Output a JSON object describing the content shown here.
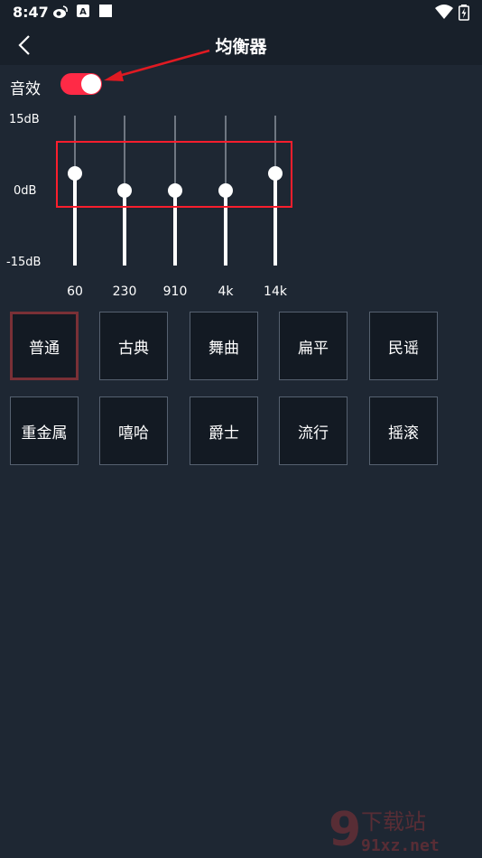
{
  "status_bar": {
    "time": "8:47",
    "icons": [
      "weibo-icon",
      "a-icon",
      "square-icon",
      "wifi-icon",
      "battery-icon"
    ]
  },
  "toolbar": {
    "title": "均衡器",
    "back_icon": "chevron-left-icon"
  },
  "sound_effect": {
    "label": "音效",
    "enabled": true,
    "on_color": "#ff2a46"
  },
  "equalizer": {
    "db_labels": {
      "max": "15dB",
      "mid": "0dB",
      "min": "-15dB"
    },
    "range_db": [
      -15,
      15
    ],
    "bands": [
      {
        "freq": "60",
        "gain_db": 3.5
      },
      {
        "freq": "230",
        "gain_db": 0
      },
      {
        "freq": "910",
        "gain_db": 0
      },
      {
        "freq": "4k",
        "gain_db": 0
      },
      {
        "freq": "14k",
        "gain_db": 3.5
      }
    ]
  },
  "presets": [
    {
      "label": "普通",
      "selected": true
    },
    {
      "label": "古典",
      "selected": false
    },
    {
      "label": "舞曲",
      "selected": false
    },
    {
      "label": "扁平",
      "selected": false
    },
    {
      "label": "民谣",
      "selected": false
    },
    {
      "label": "重金属",
      "selected": false
    },
    {
      "label": "嘻哈",
      "selected": false
    },
    {
      "label": "爵士",
      "selected": false
    },
    {
      "label": "流行",
      "selected": false
    },
    {
      "label": "摇滚",
      "selected": false
    }
  ],
  "watermark": {
    "text": "下载站",
    "url_text": "91xz.net"
  },
  "colors": {
    "background": "#1e2733",
    "annotation_red": "#ff1e2d",
    "selected_border": "#7a3036"
  }
}
